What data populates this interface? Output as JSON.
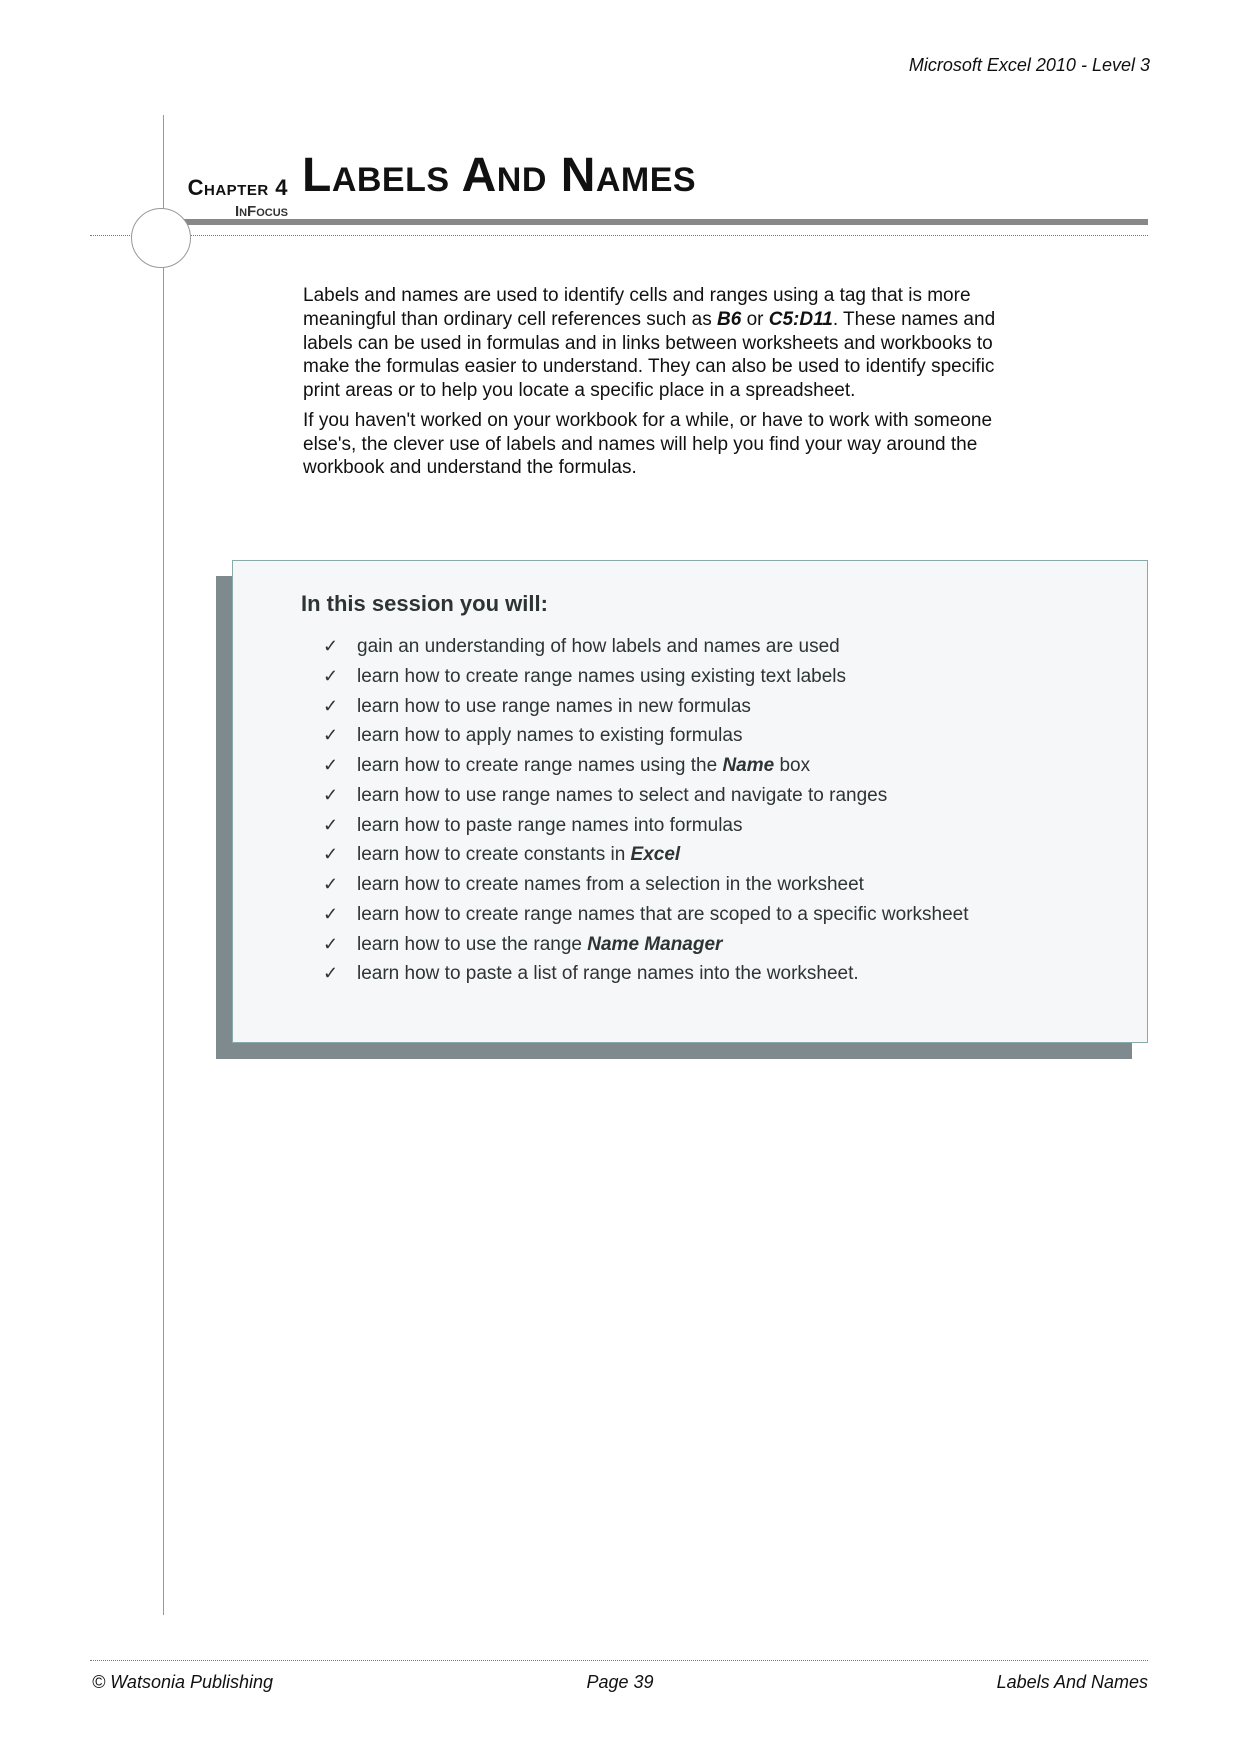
{
  "header": {
    "running": "Microsoft Excel 2010 - Level 3",
    "chapter_label": "Chapter 4",
    "infocus": "InFocus",
    "title": "Labels And Names"
  },
  "intro": {
    "p1a": "Labels and names are used to identify cells and ranges using a tag that is more meaningful than ordinary cell references such as ",
    "p1b": "B6",
    "p1c": " or ",
    "p1d": "C5:D11",
    "p1e": ". These names and labels can be used in formulas and in links between worksheets and workbooks to make the formulas easier to understand. They can also be used to identify specific print areas or to help you locate a specific place in a spreadsheet.",
    "p2": "If you haven't worked on your workbook for a while, or have to work with someone else's, the clever use of labels and names will help you find your way around the workbook and understand the formulas."
  },
  "session": {
    "heading": "In this session you will:",
    "items": [
      {
        "t": "gain an understanding of how labels and names are used"
      },
      {
        "t": "learn how to create range names using existing text labels"
      },
      {
        "t": "learn how to use range names in new formulas"
      },
      {
        "t": "learn how to apply names to existing formulas"
      },
      {
        "pre": "learn how to create range names using the ",
        "bi": "Name",
        "post": " box"
      },
      {
        "t": "learn how to use range names to select and navigate to ranges"
      },
      {
        "t": "learn how to paste range names into formulas"
      },
      {
        "pre": "learn how to create constants in ",
        "bi": "Excel",
        "post": ""
      },
      {
        "t": "learn how to create names from a selection in the worksheet"
      },
      {
        "t": "learn how to create range names that are scoped to a specific worksheet"
      },
      {
        "pre": "learn how to use the range ",
        "bi": "Name Manager",
        "post": ""
      },
      {
        "t": "learn how to paste a list of range names into the worksheet."
      }
    ]
  },
  "footer": {
    "left": "© Watsonia Publishing",
    "mid": "Page 39",
    "right": "Labels And Names"
  }
}
